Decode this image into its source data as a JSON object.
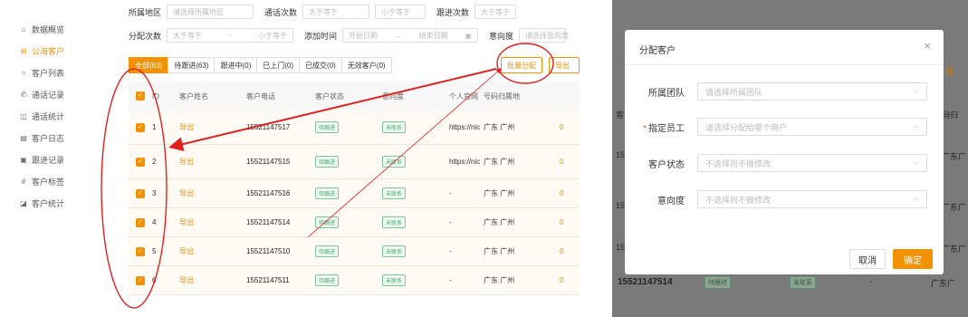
{
  "sidebar": {
    "items": [
      {
        "label": "数据概览",
        "icon": "home-icon",
        "active": false
      },
      {
        "label": "公海客户",
        "icon": "sea-icon",
        "active": true
      },
      {
        "label": "客户列表",
        "icon": "list-icon",
        "active": false
      },
      {
        "label": "通话记录",
        "icon": "phone-icon",
        "active": false
      },
      {
        "label": "通话统计",
        "icon": "stats-icon",
        "active": false
      },
      {
        "label": "客户日志",
        "icon": "calendar-icon",
        "active": false
      },
      {
        "label": "跟进记录",
        "icon": "record-icon",
        "active": false
      },
      {
        "label": "客户标签",
        "icon": "hash-icon",
        "active": false
      },
      {
        "label": "客户统计",
        "icon": "chart-icon",
        "active": false
      }
    ]
  },
  "filters": {
    "row0": {
      "label1": "所属地区",
      "placeholder1": "请选择所属地区",
      "label2": "通话次数",
      "placeholder2a": "大于等于",
      "placeholder2b": "小于等于",
      "label3": "跟进次数",
      "placeholder3": "大于等于"
    },
    "row1": {
      "label1": "分配次数",
      "placeholder1a": "大于等于",
      "sep": "~",
      "placeholder1b": "小于等于",
      "label2": "添加时间",
      "date_start": "开始日期",
      "arrow": "→",
      "date_end": "结束日期",
      "cal": "▣",
      "label3": "意向度",
      "placeholder3": "请选择意向度"
    }
  },
  "tabs": [
    {
      "label": "全部(63)",
      "active": true
    },
    {
      "label": "待跟进(63)",
      "active": false
    },
    {
      "label": "跟进中(0)",
      "active": false
    },
    {
      "label": "已上门(0)",
      "active": false
    },
    {
      "label": "已成交(0)",
      "active": false
    },
    {
      "label": "无效客户(0)",
      "active": false
    }
  ],
  "toolbar": {
    "assign_label": "批量分配",
    "export_label": "导出"
  },
  "table": {
    "headers": {
      "id": "ID",
      "name": "客户姓名",
      "phone": "客户电话",
      "status": "客户状态",
      "intent": "意向度",
      "web": "个人官网",
      "loc": "号码归属地"
    },
    "rows": [
      {
        "id": "1",
        "name": "导出",
        "phone": "15521147517",
        "status": "待跟进",
        "intent": "未联系",
        "web": "https://nicen.cn",
        "loc": "广东 广州",
        "extra": "0"
      },
      {
        "id": "2",
        "name": "导出",
        "phone": "15521147515",
        "status": "待跟进",
        "intent": "未联系",
        "web": "https://nicen.cn",
        "loc": "广东 广州",
        "extra": "0"
      },
      {
        "id": "3",
        "name": "导出",
        "phone": "15521147516",
        "status": "待跟进",
        "intent": "未联系",
        "web": "-",
        "loc": "广东 广州",
        "extra": "0"
      },
      {
        "id": "4",
        "name": "导出",
        "phone": "15521147514",
        "status": "待跟进",
        "intent": "未联系",
        "web": "-",
        "loc": "广东 广州",
        "extra": "0"
      },
      {
        "id": "5",
        "name": "导出",
        "phone": "15521147510",
        "status": "待跟进",
        "intent": "未联系",
        "web": "-",
        "loc": "广东 广州",
        "extra": "0"
      },
      {
        "id": "6",
        "name": "导出",
        "phone": "15521147511",
        "status": "待跟进",
        "intent": "未联系",
        "web": "-",
        "loc": "广东 广州",
        "extra": "0"
      }
    ]
  },
  "modal": {
    "title": "分配客户",
    "close": "×",
    "fields": [
      {
        "label": "所属团队",
        "required": false,
        "placeholder": "请选择所属团队"
      },
      {
        "label": "指定员工",
        "required": true,
        "placeholder": "请选择分配给哪个用户"
      },
      {
        "label": "客户状态",
        "required": false,
        "placeholder": "不选择则不做修改"
      },
      {
        "label": "意向度",
        "required": false,
        "placeholder": "不选择则不做修改"
      }
    ],
    "cancel_label": "取消",
    "ok_label": "确定"
  },
  "background": {
    "phone": "15521147514",
    "status": "待跟进",
    "intent": "未联系",
    "dash": "-",
    "loc_partial": "广东广",
    "side_texts": [
      "广东广",
      "广东广",
      "广东广"
    ],
    "export_btn": "批"
  },
  "colors": {
    "accent": "#f39200",
    "annotation": "#e02020",
    "overlay": "#7a7a7a"
  }
}
